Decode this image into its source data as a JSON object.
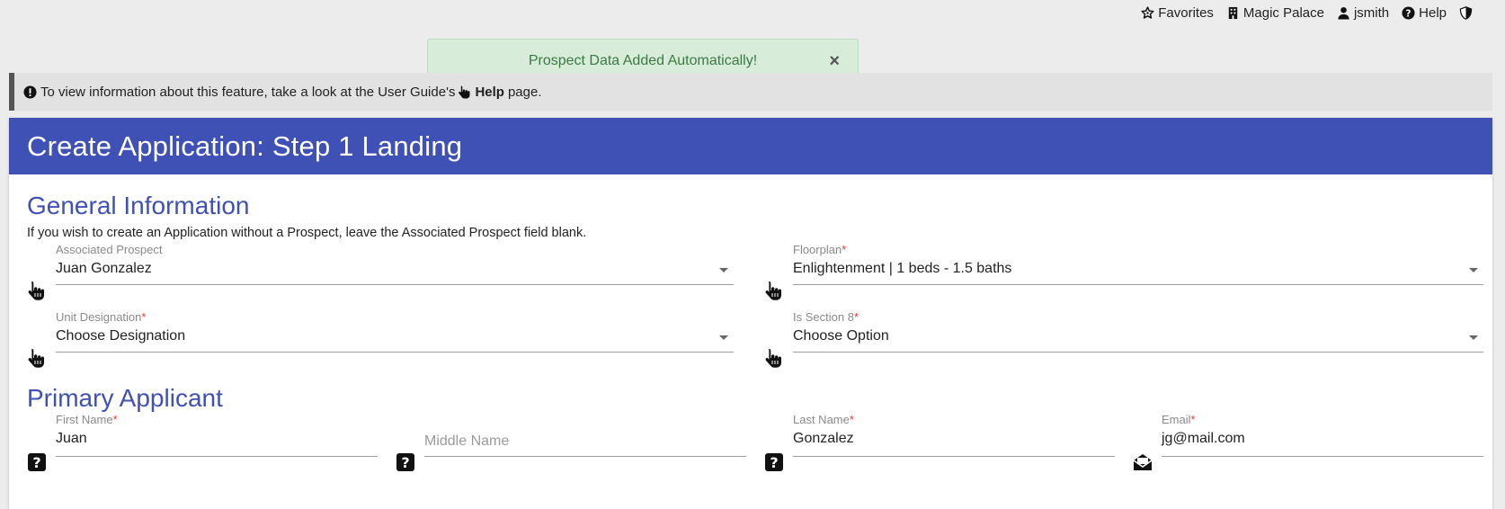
{
  "topnav": {
    "favorites": "Favorites",
    "property": "Magic Palace",
    "user": "jsmith",
    "help": "Help"
  },
  "toast": {
    "message": "Prospect Data Added Automatically!",
    "close": "×"
  },
  "infobar": {
    "text_before": "To view information about this feature, take a look at the User Guide's",
    "link": "Help",
    "text_after": "page."
  },
  "card": {
    "title": "Create Application: Step 1 Landing"
  },
  "general": {
    "title": "General Information",
    "description": "If you wish to create an Application without a Prospect, leave the Associated Prospect field blank.",
    "associated_prospect": {
      "label": "Associated Prospect",
      "value": "Juan Gonzalez"
    },
    "floorplan": {
      "label": "Floorplan",
      "required": "*",
      "value": "Enlightenment | 1 beds - 1.5 baths"
    },
    "unit_designation": {
      "label": "Unit Designation",
      "required": "*",
      "value": "Choose Designation"
    },
    "section8": {
      "label": "Is Section 8",
      "required": "*",
      "value": "Choose Option"
    }
  },
  "primary": {
    "title": "Primary Applicant",
    "first_name": {
      "label": "First Name",
      "required": "*",
      "value": "Juan"
    },
    "middle_name": {
      "placeholder": "Middle Name"
    },
    "last_name": {
      "label": "Last Name",
      "required": "*",
      "value": "Gonzalez"
    },
    "email": {
      "label": "Email",
      "required": "*",
      "value": "jg@mail.com"
    }
  },
  "colors": {
    "primary": "#3f51b5",
    "toast_bg": "#d7ecd9",
    "toast_text": "#3c7a44",
    "required": "#e53935"
  },
  "icons": [
    "star-icon",
    "building-icon",
    "user-icon",
    "question-circle-icon",
    "shield-icon",
    "exclamation-circle-icon",
    "hand-pointer-icon",
    "question-square-icon",
    "envelope-open-icon",
    "close-icon",
    "caret-down-icon"
  ]
}
